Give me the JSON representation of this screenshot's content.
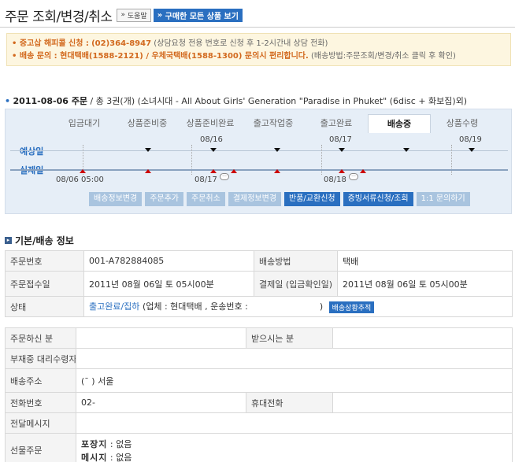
{
  "header": {
    "title": "주문 조회/변경/취소",
    "help_button": "도움말",
    "all_products_button": "구매한 모든 상품 보기"
  },
  "notice": {
    "line1_label": "증고삽 해피콜 신청 :",
    "line1_phone": "(02)364-8947",
    "line1_note": "(상담요청 전용 번호로 신청 후 1-2시간내 상담 전화)",
    "line2_label": "배송 문의 : 현대택배(1588-2121) / 우체국택배(1588-1300) 문의시 편리합니다.",
    "line2_note": "(배송방법:주문조회/변경/취소 클릭 후 확인)"
  },
  "order": {
    "date_label": "2011-08-06 주문",
    "count": "/ 총 3권(개)",
    "description": "(소녀시대 - All About Girls' Generation \"Paradise in Phuket\" (6disc + 화보집)외)"
  },
  "tabs": [
    {
      "label": "입금대기"
    },
    {
      "label": "상품준비중"
    },
    {
      "label": "상품준비완료"
    },
    {
      "label": "출고작업중"
    },
    {
      "label": "출고완료"
    },
    {
      "label": "배송중"
    },
    {
      "label": "상품수령"
    }
  ],
  "timeline": {
    "expected_label": "예상일",
    "actual_label": "실제일",
    "dates_top": [
      "08/16",
      "08/17",
      "08/19"
    ],
    "dates_bottom": [
      "08/06 05:00",
      "08/17",
      "08/18"
    ]
  },
  "actions": [
    {
      "label": "배송정보변경",
      "active": false
    },
    {
      "label": "주문추가",
      "active": false
    },
    {
      "label": "주문취소",
      "active": false
    },
    {
      "label": "결제정보변경",
      "active": false
    },
    {
      "label": "반품/교환신청",
      "active": true
    },
    {
      "label": "증빙서류신청/조회",
      "active": true
    },
    {
      "label": "1:1 문의하기",
      "active": false
    }
  ],
  "basic_info": {
    "heading": "기본/배송 정보",
    "order_no_label": "주문번호",
    "order_no": "001-A782884085",
    "ship_method_label": "배송방법",
    "ship_method": "택배",
    "order_date_label": "주문접수일",
    "order_date": "2011년 08월 06일 토 05시00분",
    "pay_date_label": "결제일 (입금확인일)",
    "pay_date": "2011년 08월 06일 토 05시00분",
    "status_label": "상태",
    "status_link": "출고완료/집하",
    "status_detail": "(업체 : 현대택배 , 운송번호 :",
    "status_close": ")",
    "track_button": "배송상황추적"
  },
  "recipient": {
    "orderer_label": "주문하신 분",
    "receiver_label": "받으시는 분",
    "proxy_label": "부재중 대리수령자",
    "address_label": "배송주소",
    "address": "(ˉ              ) 서울",
    "phone_label": "전화번호",
    "phone": "02-",
    "mobile_label": "휴대전화",
    "message_label": "전달메시지",
    "gift_label": "선물주문",
    "wrap_label": "포장지",
    "wrap_value": ": 없음",
    "msg_label": "메시지",
    "msg_value": ": 없음"
  },
  "colors": {
    "accent": "#2a6fc0",
    "marker_actual": "#cc0000",
    "notice_bg": "#fdf6e0"
  }
}
